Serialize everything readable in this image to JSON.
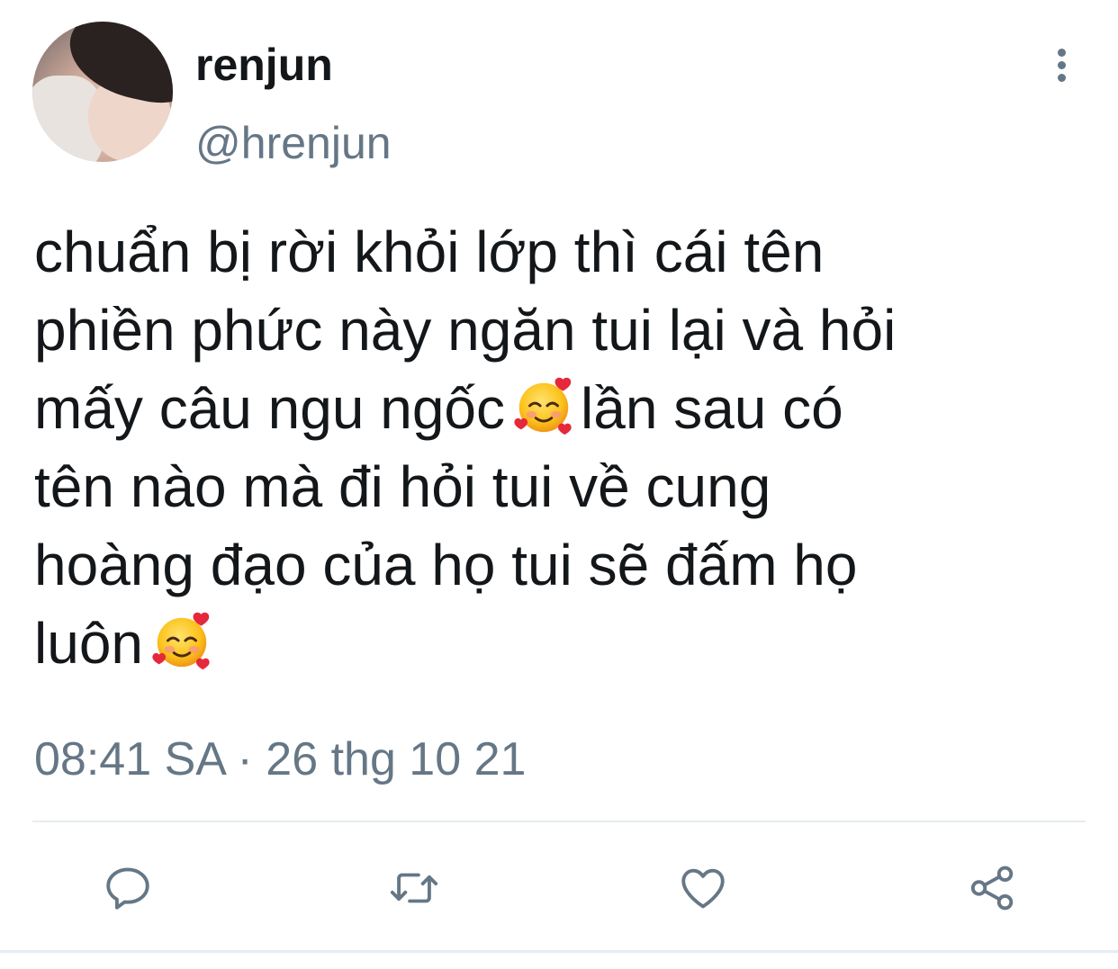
{
  "user": {
    "display_name": "renjun",
    "handle": "@hrenjun"
  },
  "tweet": {
    "lines": [
      "chuẩn bị rời khỏi lớp thì cái tên",
      "phiền phức này ngăn tui lại và hỏi",
      "mấy câu ngu ngốc",
      "lần sau có",
      "tên nào mà đi hỏi tui về cung",
      "hoàng đạo của họ tui sẽ đấm họ",
      "luôn"
    ],
    "emoji": "smiling-face-with-hearts",
    "timestamp": "08:41 SA · 26 thg 10 21"
  },
  "actions": {
    "reply_icon": "reply-icon",
    "retweet_icon": "retweet-icon",
    "like_icon": "heart-icon",
    "share_icon": "share-icon"
  },
  "colors": {
    "text": "#14171a",
    "secondary": "#657786",
    "divider": "#e6ecf0"
  }
}
